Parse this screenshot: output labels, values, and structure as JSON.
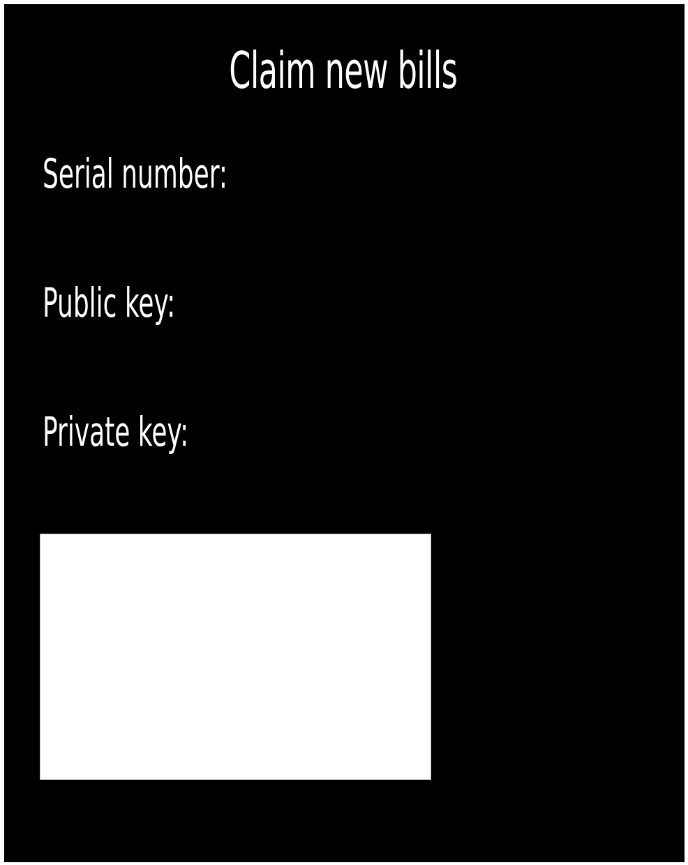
{
  "title": "Claim new bills",
  "fields": {
    "serial_label": "Serial number:",
    "public_key_label": "Public key:",
    "private_key_label": "Private key:"
  },
  "colors": {
    "background": "#000000",
    "text": "#ffffff",
    "panel": "#ffffff"
  }
}
